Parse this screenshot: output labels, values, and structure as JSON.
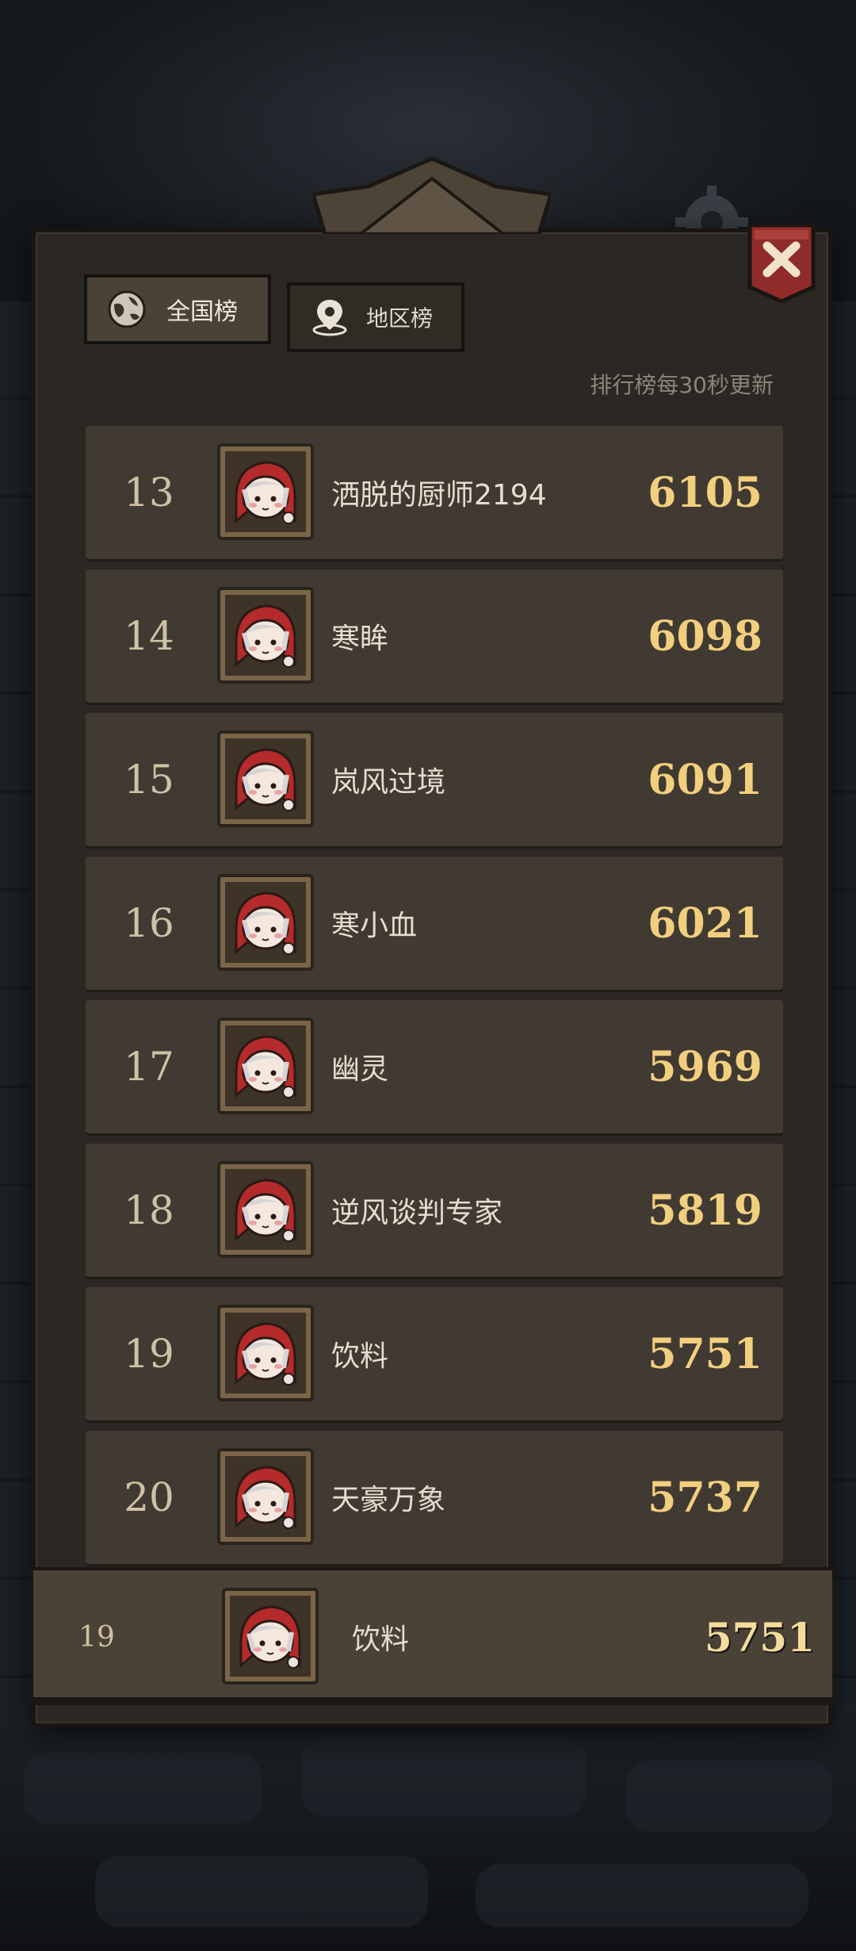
{
  "tabs": [
    {
      "label": "全国榜",
      "icon": "globe-icon",
      "active": true
    },
    {
      "label": "地区榜",
      "icon": "location-pin-icon",
      "active": false
    }
  ],
  "update_note": "排行榜每30秒更新",
  "leaderboard": [
    {
      "rank": "13",
      "name": "洒脱的厨师2194",
      "score": "6105"
    },
    {
      "rank": "14",
      "name": "寒眸",
      "score": "6098"
    },
    {
      "rank": "15",
      "name": "岚风过境",
      "score": "6091"
    },
    {
      "rank": "16",
      "name": "寒小血",
      "score": "6021"
    },
    {
      "rank": "17",
      "name": "幽灵",
      "score": "5969"
    },
    {
      "rank": "18",
      "name": "逆风谈判专家",
      "score": "5819"
    },
    {
      "rank": "19",
      "name": "饮料",
      "score": "5751"
    },
    {
      "rank": "20",
      "name": "天豪万象",
      "score": "5737"
    }
  ],
  "self_entry": {
    "rank": "19",
    "name": "饮料",
    "score": "5751"
  },
  "colors": {
    "panel": "#2b2824",
    "row": "#403a32",
    "score": "#f2cf7e",
    "close_button": "#8f2c2a"
  }
}
